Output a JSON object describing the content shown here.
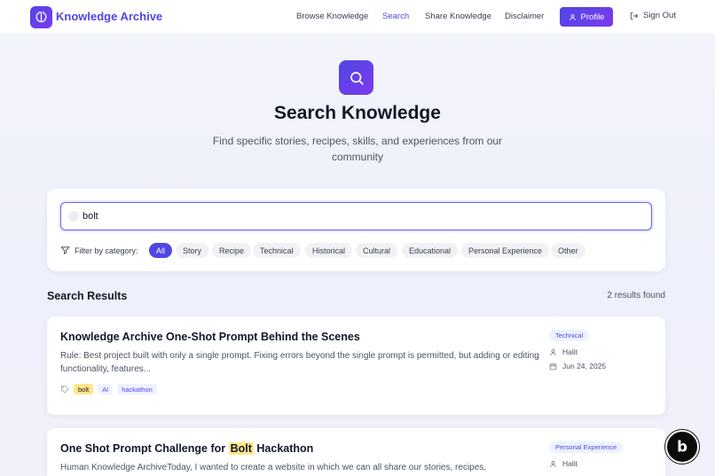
{
  "header": {
    "brand": "Knowledge Archive",
    "nav": [
      "Browse Knowledge",
      "Search",
      "Share Knowledge",
      "Disclaimer"
    ],
    "profile_label": "Profile",
    "signout_label": "Sign Out"
  },
  "hero": {
    "title": "Search Knowledge",
    "subtitle": "Find specific stories, recipes, skills, and experiences from our community"
  },
  "search": {
    "value": "bolt",
    "filter_label": "Filter by category:",
    "categories": [
      "All",
      "Story",
      "Recipe",
      "Technical",
      "Historical",
      "Cultural",
      "Educational",
      "Personal Experience",
      "Other"
    ],
    "active_category": "All"
  },
  "results": {
    "title": "Search Results",
    "count": "2 results found",
    "items": [
      {
        "title": "Knowledge Archive One-Shot Prompt Behind the Scenes",
        "body": "Rule: Best project built with only a single prompt. Fixing errors beyond the single prompt is permitted, but adding or editing functionality, features...",
        "category": "Technical",
        "author": "Halit",
        "date": "Jun 24, 2025",
        "tags": [
          "bolt",
          "AI",
          "hackathon"
        ]
      },
      {
        "title_pre": "One Shot Prompt Challenge for",
        "title_hl": "Bolt",
        "title_post": "Hackathon",
        "body": "Human Knowledge ArchiveToday, I wanted to create a website in which we can all share our stories, recipes,",
        "category": "Personal Experience",
        "author": "Halit"
      }
    ]
  },
  "colors": {
    "accent": "#4f46e5",
    "accent2": "#7c3aed",
    "highlight": "#fde68a"
  }
}
